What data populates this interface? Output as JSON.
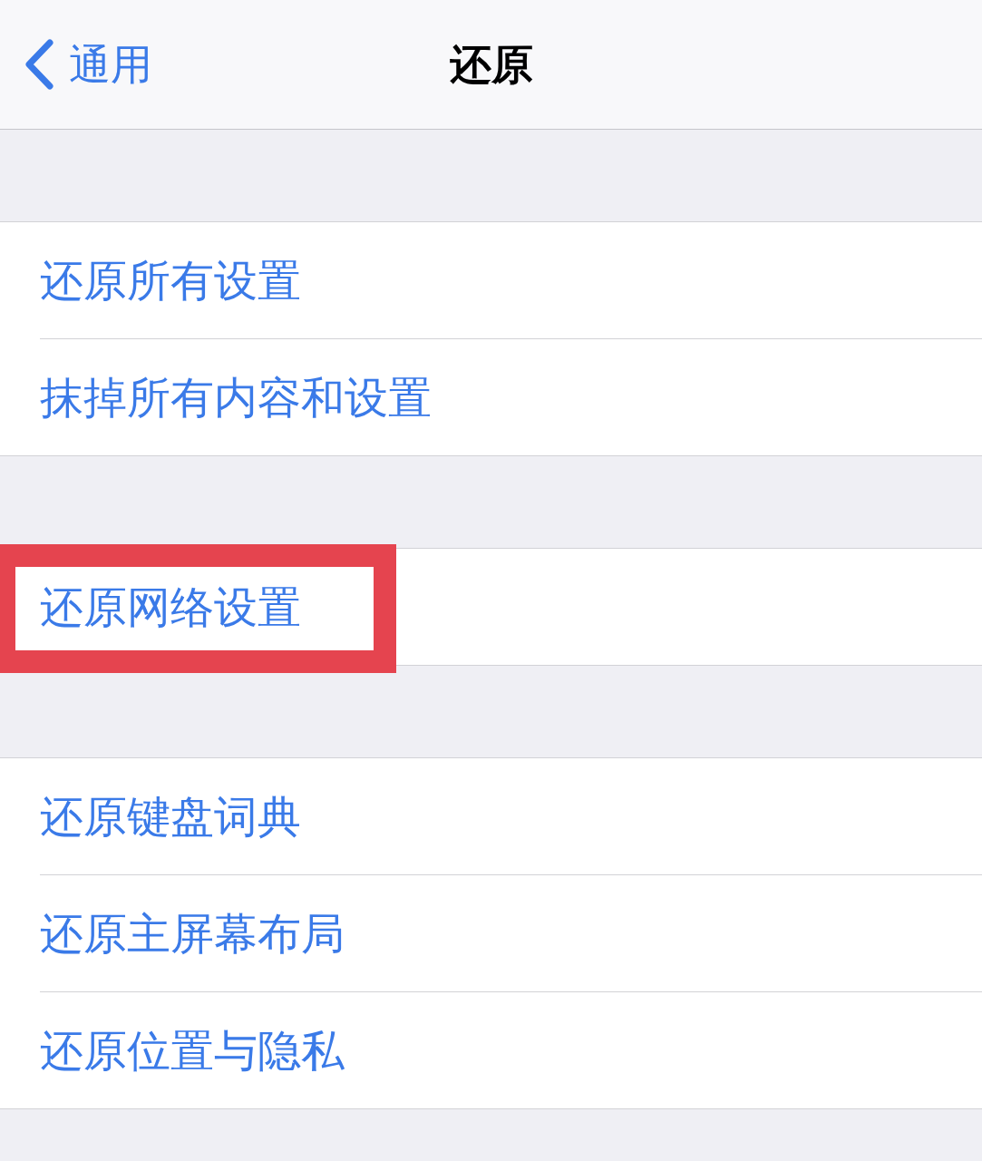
{
  "nav_bar": {
    "back_label": "通用",
    "title": "还原"
  },
  "groups": [
    {
      "rows": [
        {
          "label": "还原所有设置",
          "highlighted": false
        },
        {
          "label": "抹掉所有内容和设置",
          "highlighted": false
        }
      ]
    },
    {
      "rows": [
        {
          "label": "还原网络设置",
          "highlighted": true
        }
      ]
    },
    {
      "rows": [
        {
          "label": "还原键盘词典",
          "highlighted": false
        },
        {
          "label": "还原主屏幕布局",
          "highlighted": false
        },
        {
          "label": "还原位置与隐私",
          "highlighted": false
        }
      ]
    }
  ]
}
